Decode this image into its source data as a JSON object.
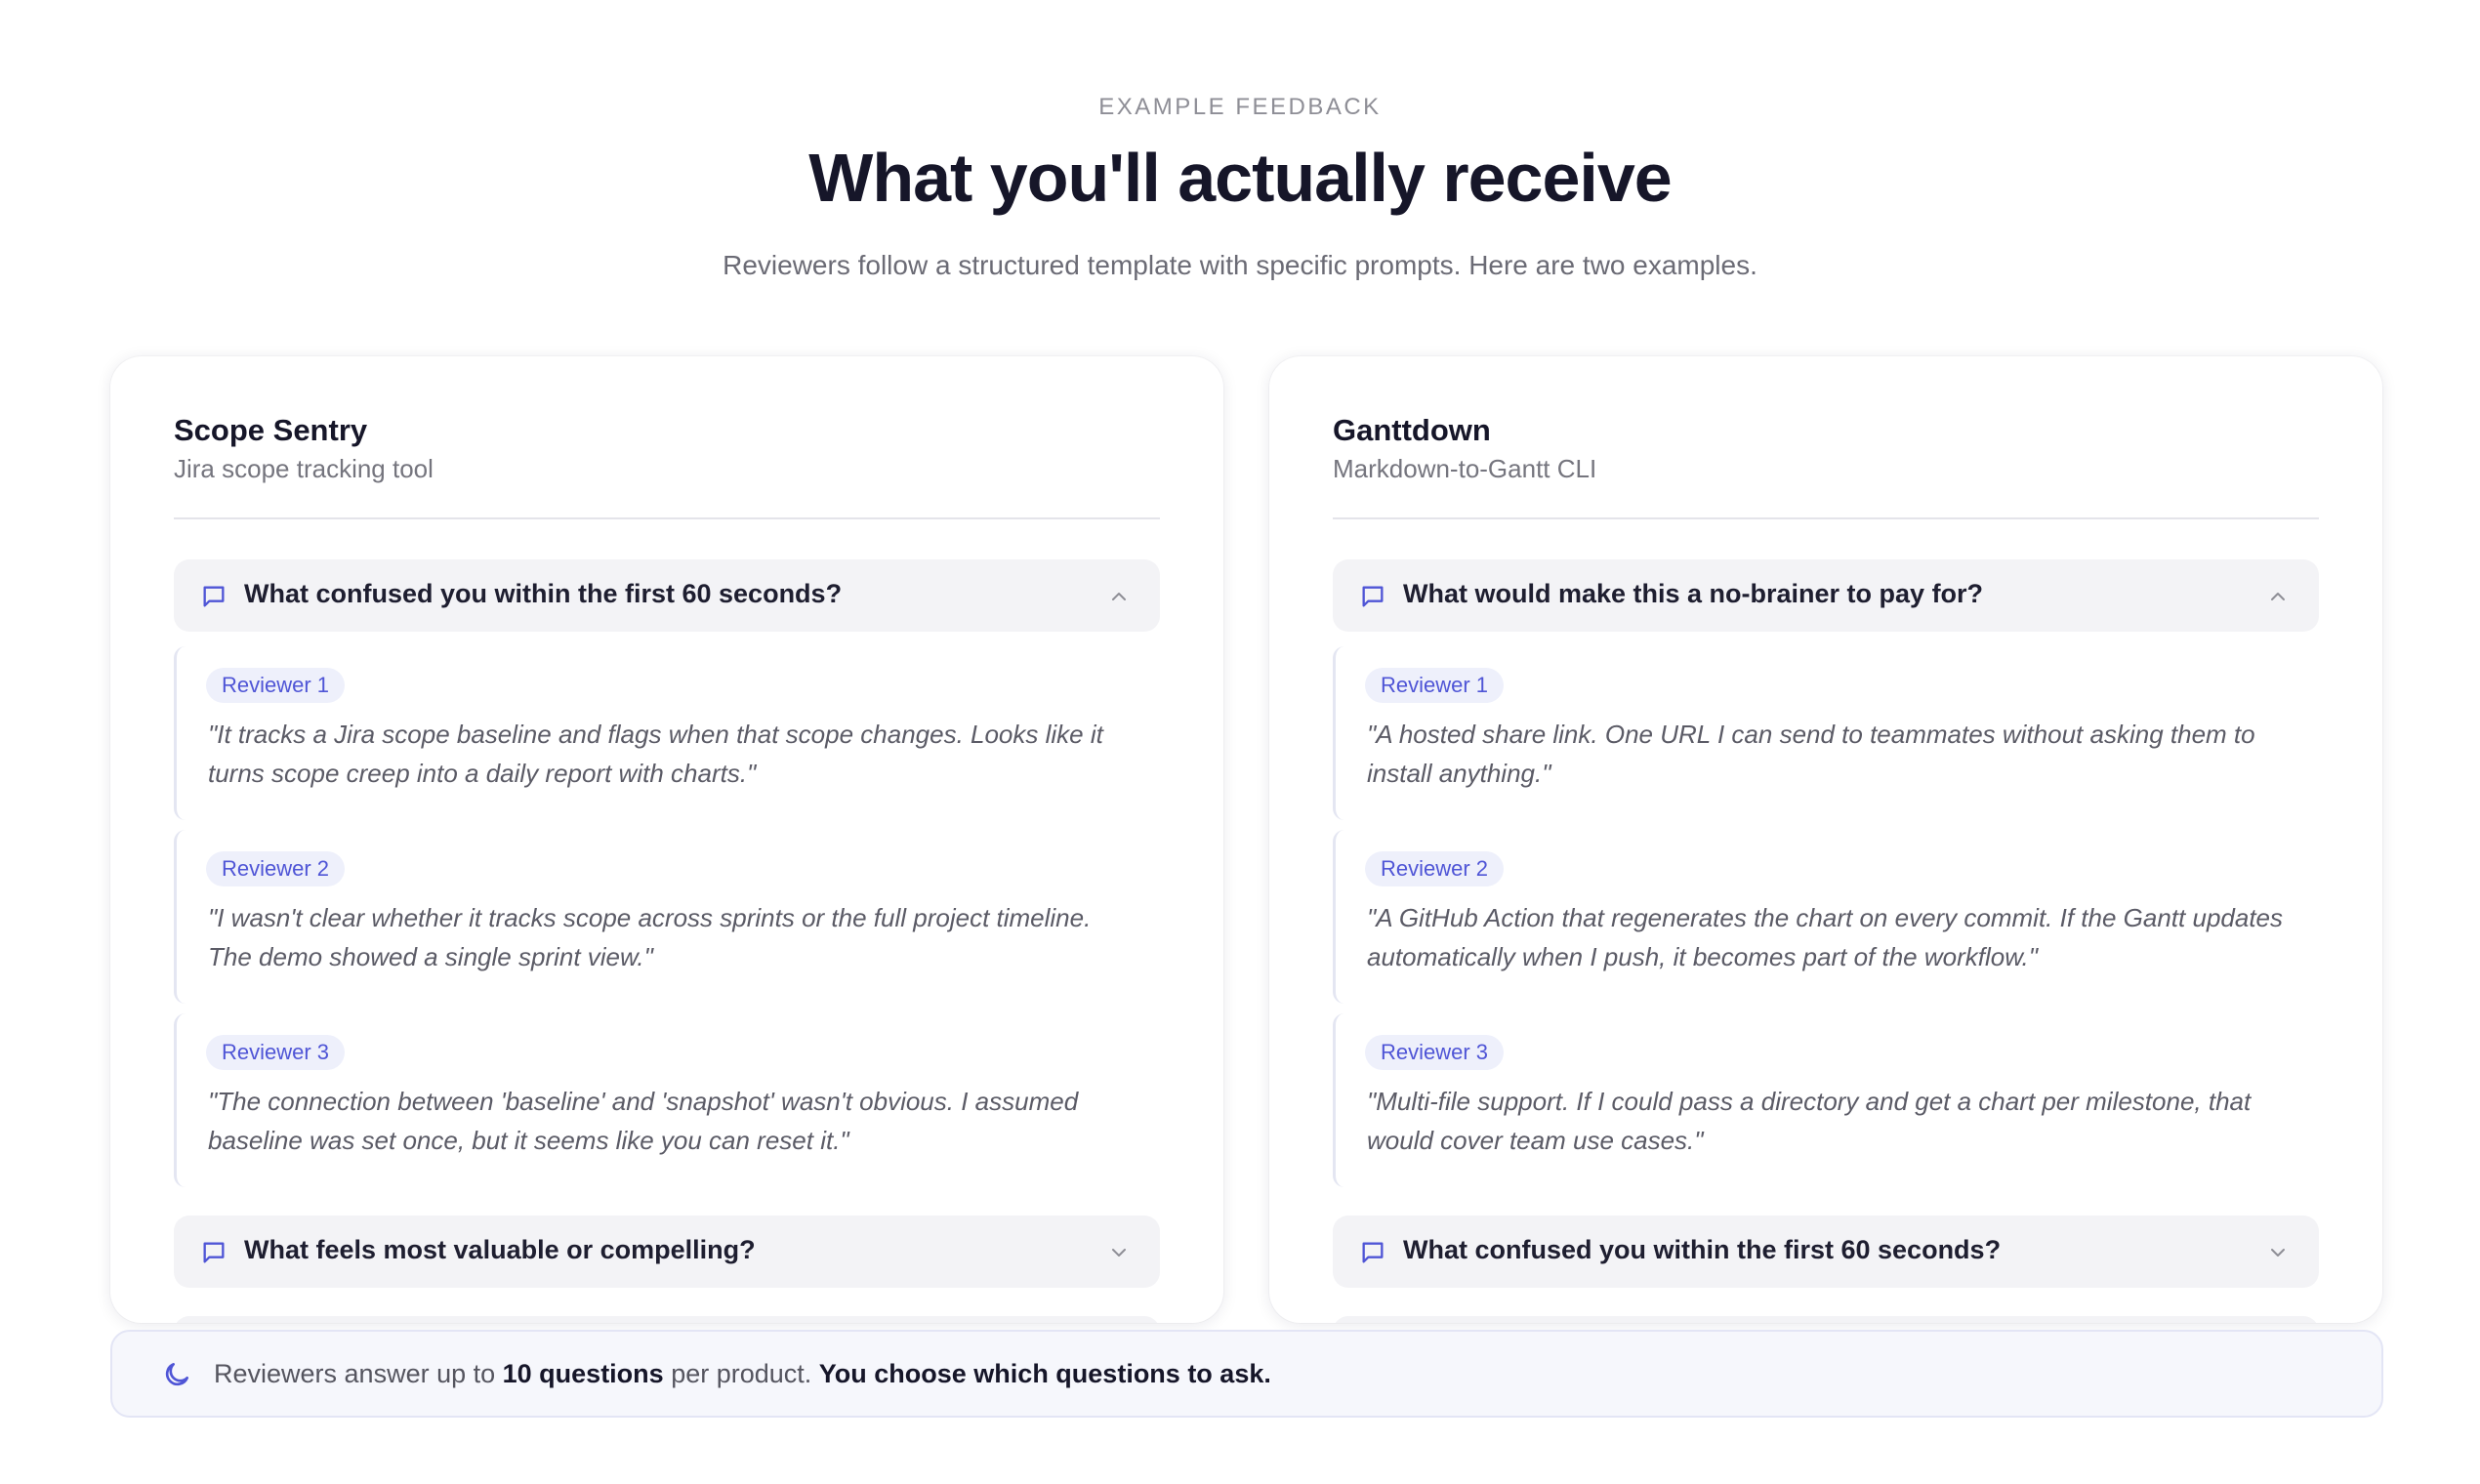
{
  "header": {
    "eyebrow": "EXAMPLE FEEDBACK",
    "title": "What you'll actually receive",
    "subtitle": "Reviewers follow a structured template with specific prompts. Here are two examples."
  },
  "colors": {
    "accent": "#4f55d6",
    "badge_bg": "#eef0fb",
    "question_bg": "#f3f3f6",
    "footer_bg": "#f6f7fc"
  },
  "icons": {
    "question": "message-square-icon",
    "expanded": "chevron-up-icon",
    "collapsed": "chevron-down-icon",
    "footer": "moon-icon"
  },
  "cards": [
    {
      "name": "Scope Sentry",
      "description": "Jira scope tracking tool",
      "questions": [
        {
          "text": "What confused you within the first 60 seconds?",
          "expanded": true,
          "answers": [
            {
              "reviewer": "Reviewer 1",
              "quote": "\"It tracks a Jira scope baseline and flags when that scope changes. Looks like it turns scope creep into a daily report with charts.\""
            },
            {
              "reviewer": "Reviewer 2",
              "quote": "\"I wasn't clear whether it tracks scope across sprints or the full project timeline. The demo showed a single sprint view.\""
            },
            {
              "reviewer": "Reviewer 3",
              "quote": "\"The connection between 'baseline' and 'snapshot' wasn't obvious. I assumed baseline was set once, but it seems like you can reset it.\""
            }
          ]
        },
        {
          "text": "What feels most valuable or compelling?",
          "expanded": false
        }
      ]
    },
    {
      "name": "Ganttdown",
      "description": "Markdown-to-Gantt CLI",
      "questions": [
        {
          "text": "What would make this a no-brainer to pay for?",
          "expanded": true,
          "answers": [
            {
              "reviewer": "Reviewer 1",
              "quote": "\"A hosted share link. One URL I can send to teammates without asking them to install anything.\""
            },
            {
              "reviewer": "Reviewer 2",
              "quote": "\"A GitHub Action that regenerates the chart on every commit. If the Gantt updates automatically when I push, it becomes part of the workflow.\""
            },
            {
              "reviewer": "Reviewer 3",
              "quote": "\"Multi-file support. If I could pass a directory and get a chart per milestone, that would cover team use cases.\""
            }
          ]
        },
        {
          "text": "What confused you within the first 60 seconds?",
          "expanded": false
        }
      ]
    }
  ],
  "footer": {
    "text_1": "Reviewers answer up to ",
    "bold_1": "10 questions",
    "text_2": " per product. ",
    "bold_2": "You choose which questions to ask."
  }
}
